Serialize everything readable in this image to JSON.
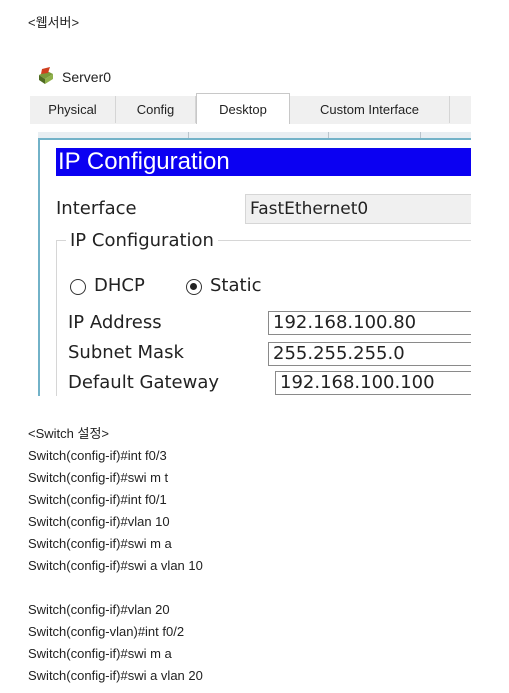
{
  "heading_web": "<웹서버>",
  "pt": {
    "window_title": "Server0",
    "tabs": [
      "Physical",
      "Config",
      "Desktop",
      "Custom Interface"
    ],
    "active_tab": "Desktop",
    "ip_config_header": "IP Configuration",
    "interface_label": "Interface",
    "interface_value": "FastEthernet0",
    "group_title": "IP Configuration",
    "dhcp_label": "DHCP",
    "static_label": "Static",
    "selected_mode": "Static",
    "ip_label": "IP Address",
    "ip_value": "192.168.100.80",
    "subnet_label": "Subnet Mask",
    "subnet_value": "255.255.255.0",
    "gateway_label": "Default Gateway",
    "gateway_value": "192.168.100.100",
    "colors": {
      "header_blue": "#0b00f2",
      "frame_border": "#72b2c8"
    }
  },
  "switch_heading": "<Switch 설정>",
  "commands": [
    "Switch(config-if)#int f0/3",
    "Switch(config-if)#swi m t",
    "Switch(config-if)#int f0/1",
    "Switch(config-if)#vlan 10",
    "Switch(config-if)#swi m a",
    "Switch(config-if)#swi a vlan 10",
    "",
    "Switch(config-if)#vlan 20",
    "Switch(config-vlan)#int f0/2",
    "Switch(config-if)#swi m a",
    "Switch(config-if)#swi a vlan 20"
  ]
}
